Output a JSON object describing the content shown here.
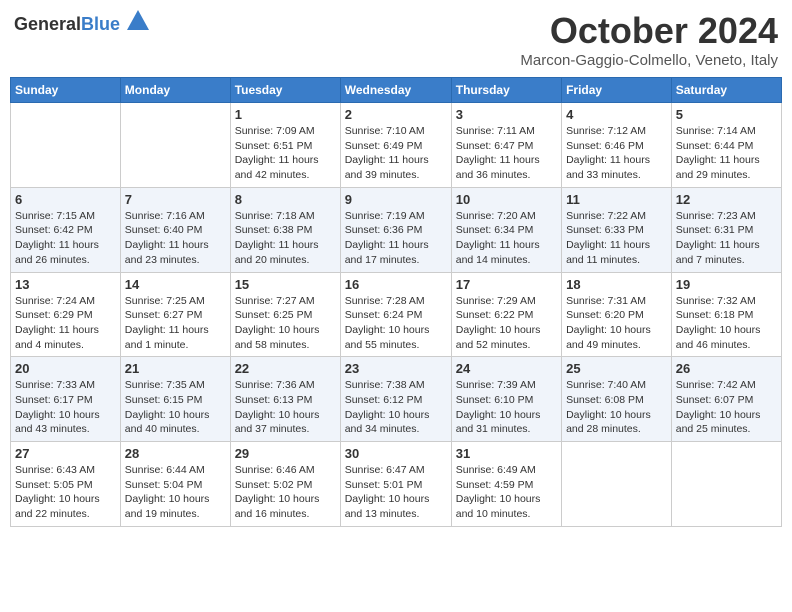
{
  "header": {
    "logo_general": "General",
    "logo_blue": "Blue",
    "month": "October 2024",
    "location": "Marcon-Gaggio-Colmello, Veneto, Italy"
  },
  "days_of_week": [
    "Sunday",
    "Monday",
    "Tuesday",
    "Wednesday",
    "Thursday",
    "Friday",
    "Saturday"
  ],
  "weeks": [
    [
      {
        "day": "",
        "info": ""
      },
      {
        "day": "",
        "info": ""
      },
      {
        "day": "1",
        "sunrise": "Sunrise: 7:09 AM",
        "sunset": "Sunset: 6:51 PM",
        "daylight": "Daylight: 11 hours and 42 minutes."
      },
      {
        "day": "2",
        "sunrise": "Sunrise: 7:10 AM",
        "sunset": "Sunset: 6:49 PM",
        "daylight": "Daylight: 11 hours and 39 minutes."
      },
      {
        "day": "3",
        "sunrise": "Sunrise: 7:11 AM",
        "sunset": "Sunset: 6:47 PM",
        "daylight": "Daylight: 11 hours and 36 minutes."
      },
      {
        "day": "4",
        "sunrise": "Sunrise: 7:12 AM",
        "sunset": "Sunset: 6:46 PM",
        "daylight": "Daylight: 11 hours and 33 minutes."
      },
      {
        "day": "5",
        "sunrise": "Sunrise: 7:14 AM",
        "sunset": "Sunset: 6:44 PM",
        "daylight": "Daylight: 11 hours and 29 minutes."
      }
    ],
    [
      {
        "day": "6",
        "sunrise": "Sunrise: 7:15 AM",
        "sunset": "Sunset: 6:42 PM",
        "daylight": "Daylight: 11 hours and 26 minutes."
      },
      {
        "day": "7",
        "sunrise": "Sunrise: 7:16 AM",
        "sunset": "Sunset: 6:40 PM",
        "daylight": "Daylight: 11 hours and 23 minutes."
      },
      {
        "day": "8",
        "sunrise": "Sunrise: 7:18 AM",
        "sunset": "Sunset: 6:38 PM",
        "daylight": "Daylight: 11 hours and 20 minutes."
      },
      {
        "day": "9",
        "sunrise": "Sunrise: 7:19 AM",
        "sunset": "Sunset: 6:36 PM",
        "daylight": "Daylight: 11 hours and 17 minutes."
      },
      {
        "day": "10",
        "sunrise": "Sunrise: 7:20 AM",
        "sunset": "Sunset: 6:34 PM",
        "daylight": "Daylight: 11 hours and 14 minutes."
      },
      {
        "day": "11",
        "sunrise": "Sunrise: 7:22 AM",
        "sunset": "Sunset: 6:33 PM",
        "daylight": "Daylight: 11 hours and 11 minutes."
      },
      {
        "day": "12",
        "sunrise": "Sunrise: 7:23 AM",
        "sunset": "Sunset: 6:31 PM",
        "daylight": "Daylight: 11 hours and 7 minutes."
      }
    ],
    [
      {
        "day": "13",
        "sunrise": "Sunrise: 7:24 AM",
        "sunset": "Sunset: 6:29 PM",
        "daylight": "Daylight: 11 hours and 4 minutes."
      },
      {
        "day": "14",
        "sunrise": "Sunrise: 7:25 AM",
        "sunset": "Sunset: 6:27 PM",
        "daylight": "Daylight: 11 hours and 1 minute."
      },
      {
        "day": "15",
        "sunrise": "Sunrise: 7:27 AM",
        "sunset": "Sunset: 6:25 PM",
        "daylight": "Daylight: 10 hours and 58 minutes."
      },
      {
        "day": "16",
        "sunrise": "Sunrise: 7:28 AM",
        "sunset": "Sunset: 6:24 PM",
        "daylight": "Daylight: 10 hours and 55 minutes."
      },
      {
        "day": "17",
        "sunrise": "Sunrise: 7:29 AM",
        "sunset": "Sunset: 6:22 PM",
        "daylight": "Daylight: 10 hours and 52 minutes."
      },
      {
        "day": "18",
        "sunrise": "Sunrise: 7:31 AM",
        "sunset": "Sunset: 6:20 PM",
        "daylight": "Daylight: 10 hours and 49 minutes."
      },
      {
        "day": "19",
        "sunrise": "Sunrise: 7:32 AM",
        "sunset": "Sunset: 6:18 PM",
        "daylight": "Daylight: 10 hours and 46 minutes."
      }
    ],
    [
      {
        "day": "20",
        "sunrise": "Sunrise: 7:33 AM",
        "sunset": "Sunset: 6:17 PM",
        "daylight": "Daylight: 10 hours and 43 minutes."
      },
      {
        "day": "21",
        "sunrise": "Sunrise: 7:35 AM",
        "sunset": "Sunset: 6:15 PM",
        "daylight": "Daylight: 10 hours and 40 minutes."
      },
      {
        "day": "22",
        "sunrise": "Sunrise: 7:36 AM",
        "sunset": "Sunset: 6:13 PM",
        "daylight": "Daylight: 10 hours and 37 minutes."
      },
      {
        "day": "23",
        "sunrise": "Sunrise: 7:38 AM",
        "sunset": "Sunset: 6:12 PM",
        "daylight": "Daylight: 10 hours and 34 minutes."
      },
      {
        "day": "24",
        "sunrise": "Sunrise: 7:39 AM",
        "sunset": "Sunset: 6:10 PM",
        "daylight": "Daylight: 10 hours and 31 minutes."
      },
      {
        "day": "25",
        "sunrise": "Sunrise: 7:40 AM",
        "sunset": "Sunset: 6:08 PM",
        "daylight": "Daylight: 10 hours and 28 minutes."
      },
      {
        "day": "26",
        "sunrise": "Sunrise: 7:42 AM",
        "sunset": "Sunset: 6:07 PM",
        "daylight": "Daylight: 10 hours and 25 minutes."
      }
    ],
    [
      {
        "day": "27",
        "sunrise": "Sunrise: 6:43 AM",
        "sunset": "Sunset: 5:05 PM",
        "daylight": "Daylight: 10 hours and 22 minutes."
      },
      {
        "day": "28",
        "sunrise": "Sunrise: 6:44 AM",
        "sunset": "Sunset: 5:04 PM",
        "daylight": "Daylight: 10 hours and 19 minutes."
      },
      {
        "day": "29",
        "sunrise": "Sunrise: 6:46 AM",
        "sunset": "Sunset: 5:02 PM",
        "daylight": "Daylight: 10 hours and 16 minutes."
      },
      {
        "day": "30",
        "sunrise": "Sunrise: 6:47 AM",
        "sunset": "Sunset: 5:01 PM",
        "daylight": "Daylight: 10 hours and 13 minutes."
      },
      {
        "day": "31",
        "sunrise": "Sunrise: 6:49 AM",
        "sunset": "Sunset: 4:59 PM",
        "daylight": "Daylight: 10 hours and 10 minutes."
      },
      {
        "day": "",
        "info": ""
      },
      {
        "day": "",
        "info": ""
      }
    ]
  ]
}
